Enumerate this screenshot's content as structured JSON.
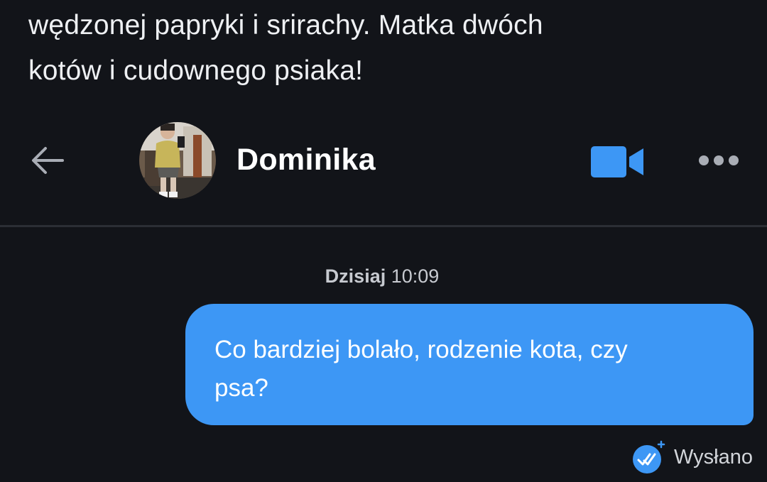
{
  "profile_bio": {
    "text": "wędzonej papryki i srirachy.  Matka dwóch\nkotów i cudownego psiaka!"
  },
  "header": {
    "contact_name": "Dominika",
    "icons": {
      "back": "arrow-left-icon",
      "video": "video-call-icon",
      "more": "more-dots-icon"
    },
    "accent_color": "#3d97f5"
  },
  "conversation": {
    "date_label": "Dzisiaj",
    "time_label": "10:09",
    "messages": [
      {
        "direction": "outgoing",
        "text": "Co bardziej bolało, rodzenie kota, czy\npsa?"
      }
    ],
    "status": {
      "label": "Wysłano",
      "icon": "double-check-icon"
    }
  },
  "colors": {
    "background": "#121419",
    "bubble": "#3d97f5",
    "divider": "#2b2e35"
  }
}
